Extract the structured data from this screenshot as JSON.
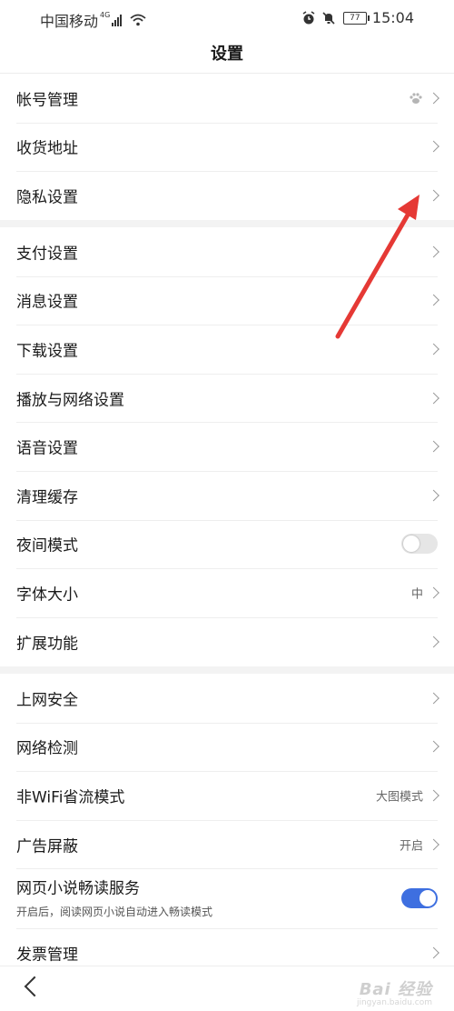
{
  "status_bar": {
    "carrier": "中国移动",
    "network": "4G",
    "battery": "77",
    "time": "15:04"
  },
  "title": "设置",
  "groups": [
    {
      "rows": [
        {
          "label": "帐号管理",
          "icon": "baidu-paw-icon"
        },
        {
          "label": "收货地址"
        },
        {
          "label": "隐私设置"
        }
      ]
    },
    {
      "rows": [
        {
          "label": "支付设置"
        },
        {
          "label": "消息设置"
        },
        {
          "label": "下载设置"
        },
        {
          "label": "播放与网络设置"
        },
        {
          "label": "语音设置"
        },
        {
          "label": "清理缓存"
        },
        {
          "label": "夜间模式",
          "toggle": false
        },
        {
          "label": "字体大小",
          "value": "中"
        },
        {
          "label": "扩展功能"
        }
      ]
    },
    {
      "rows": [
        {
          "label": "上网安全"
        },
        {
          "label": "网络检测"
        },
        {
          "label": "非WiFi省流模式",
          "value": "大图模式"
        },
        {
          "label": "广告屏蔽",
          "value": "开启"
        },
        {
          "label": "网页小说畅读服务",
          "sub": "开启后，阅读网页小说自动进入畅读模式",
          "toggle": true
        },
        {
          "label": "发票管理"
        }
      ]
    }
  ],
  "watermark": {
    "text": "Bai 经验",
    "sub": "jingyan.baidu.com"
  },
  "colors": {
    "toggle_on": "#3e6fe0",
    "annotation_arrow": "#e53935"
  }
}
